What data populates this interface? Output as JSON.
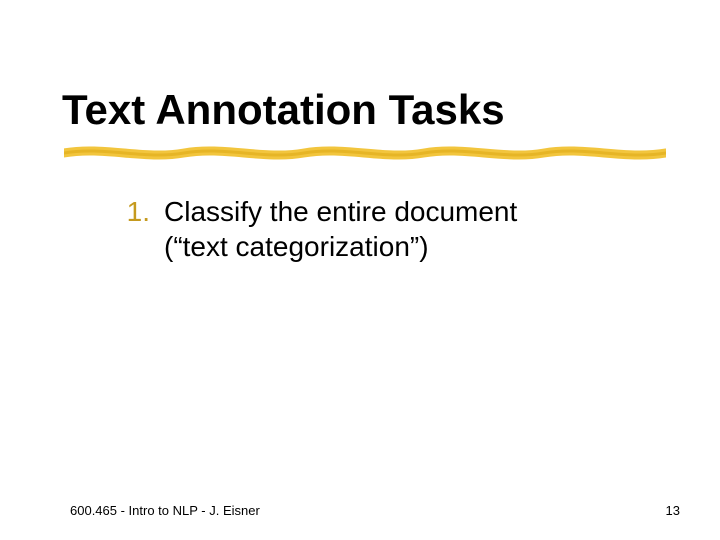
{
  "title": "Text Annotation Tasks",
  "list": {
    "num1": "1.",
    "item1_line1": "Classify the entire document",
    "item1_line2": "(“text categorization”)"
  },
  "footer": {
    "left": "600.465 - Intro to NLP - J. Eisner",
    "right": "13"
  }
}
